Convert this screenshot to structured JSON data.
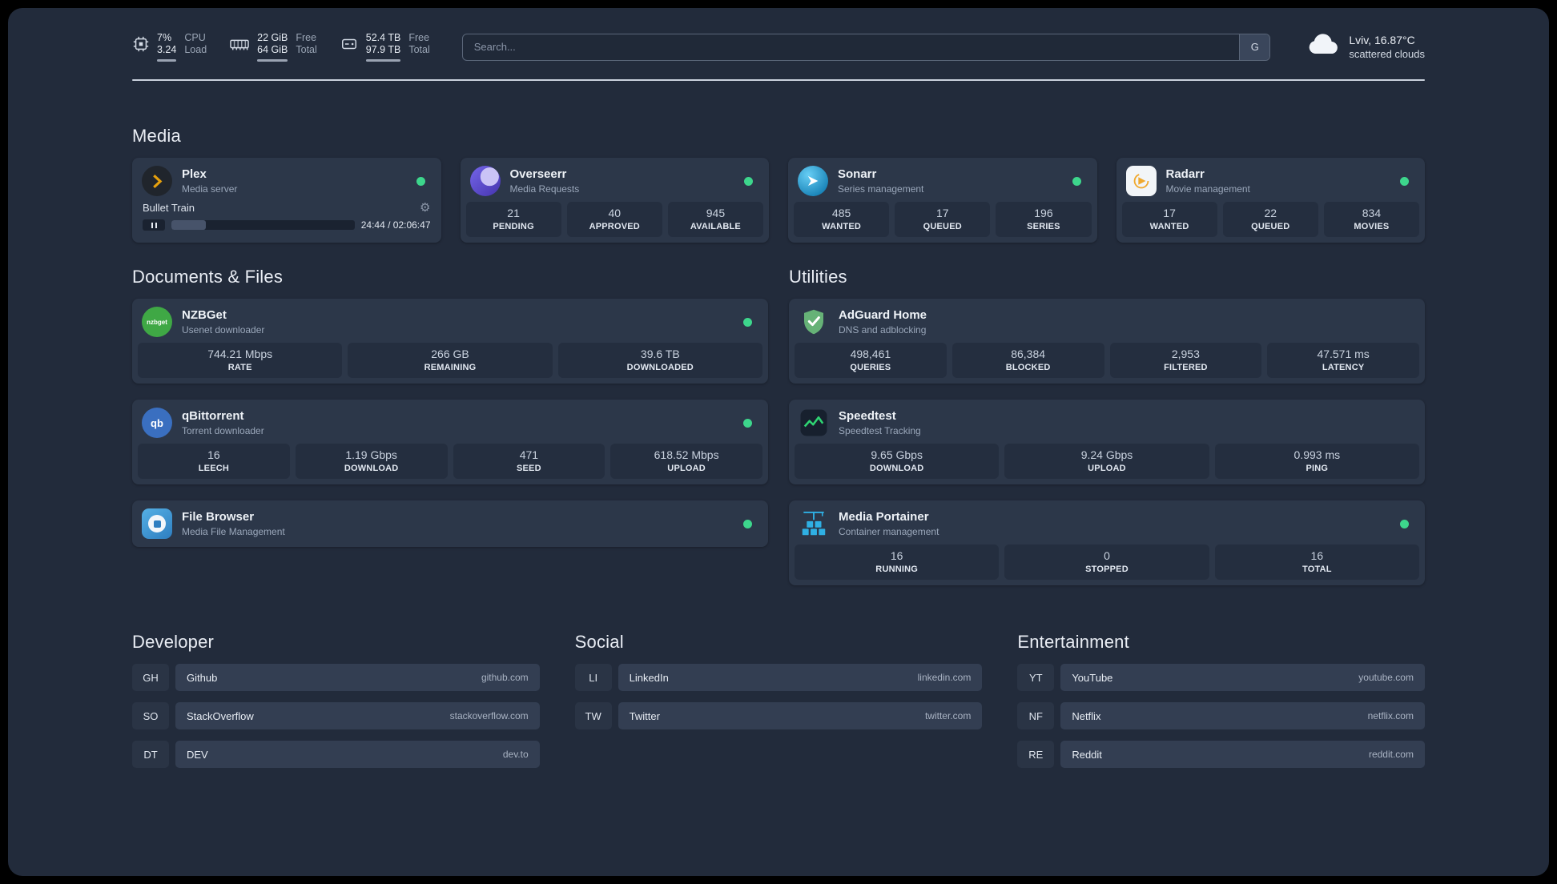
{
  "icons": {
    "gear": "⚙"
  },
  "topbar": {
    "cpu": {
      "value_top": "7%",
      "value_bottom": "3.24",
      "label_top": "CPU",
      "label_bottom": "Load"
    },
    "ram": {
      "value_top": "22 GiB",
      "value_bottom": "64 GiB",
      "label_top": "Free",
      "label_bottom": "Total"
    },
    "disk": {
      "value_top": "52.4 TB",
      "value_bottom": "97.9 TB",
      "label_top": "Free",
      "label_bottom": "Total"
    },
    "search": {
      "placeholder": "Search...",
      "button_label": "G"
    },
    "weather": {
      "location": "Lviv, 16.87°C",
      "condition": "scattered clouds"
    }
  },
  "section_titles": {
    "media": "Media",
    "documents": "Documents & Files",
    "utilities": "Utilities",
    "developer": "Developer",
    "social": "Social",
    "entertainment": "Entertainment"
  },
  "apps": {
    "plex": {
      "name": "Plex",
      "desc": "Media server",
      "now_playing": "Bullet Train",
      "time": "24:44 / 02:06:47",
      "progress_percent": 19
    },
    "overseerr": {
      "name": "Overseerr",
      "desc": "Media Requests",
      "stats": [
        {
          "value": "21",
          "label": "PENDING"
        },
        {
          "value": "40",
          "label": "APPROVED"
        },
        {
          "value": "945",
          "label": "AVAILABLE"
        }
      ]
    },
    "sonarr": {
      "name": "Sonarr",
      "desc": "Series management",
      "stats": [
        {
          "value": "485",
          "label": "WANTED"
        },
        {
          "value": "17",
          "label": "QUEUED"
        },
        {
          "value": "196",
          "label": "SERIES"
        }
      ]
    },
    "radarr": {
      "name": "Radarr",
      "desc": "Movie management",
      "stats": [
        {
          "value": "17",
          "label": "WANTED"
        },
        {
          "value": "22",
          "label": "QUEUED"
        },
        {
          "value": "834",
          "label": "MOVIES"
        }
      ]
    },
    "nzbget": {
      "name": "NZBGet",
      "desc": "Usenet downloader",
      "icon_text": "nzbget",
      "stats": [
        {
          "value": "744.21 Mbps",
          "label": "RATE"
        },
        {
          "value": "266 GB",
          "label": "REMAINING"
        },
        {
          "value": "39.6 TB",
          "label": "DOWNLOADED"
        }
      ]
    },
    "qbittorrent": {
      "name": "qBittorrent",
      "desc": "Torrent downloader",
      "icon_text": "qb",
      "stats": [
        {
          "value": "16",
          "label": "LEECH"
        },
        {
          "value": "1.19 Gbps",
          "label": "DOWNLOAD"
        },
        {
          "value": "471",
          "label": "SEED"
        },
        {
          "value": "618.52 Mbps",
          "label": "UPLOAD"
        }
      ]
    },
    "filebrowser": {
      "name": "File Browser",
      "desc": "Media File Management"
    },
    "adguard": {
      "name": "AdGuard Home",
      "desc": "DNS and adblocking",
      "stats": [
        {
          "value": "498,461",
          "label": "QUERIES"
        },
        {
          "value": "86,384",
          "label": "BLOCKED"
        },
        {
          "value": "2,953",
          "label": "FILTERED"
        },
        {
          "value": "47.571 ms",
          "label": "LATENCY"
        }
      ]
    },
    "speedtest": {
      "name": "Speedtest",
      "desc": "Speedtest Tracking",
      "stats": [
        {
          "value": "9.65 Gbps",
          "label": "DOWNLOAD"
        },
        {
          "value": "9.24 Gbps",
          "label": "UPLOAD"
        },
        {
          "value": "0.993 ms",
          "label": "PING"
        }
      ]
    },
    "portainer": {
      "name": "Media Portainer",
      "desc": "Container management",
      "stats": [
        {
          "value": "16",
          "label": "RUNNING"
        },
        {
          "value": "0",
          "label": "STOPPED"
        },
        {
          "value": "16",
          "label": "TOTAL"
        }
      ]
    }
  },
  "bookmarks": {
    "developer": [
      {
        "abbr": "GH",
        "name": "Github",
        "url": "github.com"
      },
      {
        "abbr": "SO",
        "name": "StackOverflow",
        "url": "stackoverflow.com"
      },
      {
        "abbr": "DT",
        "name": "DEV",
        "url": "dev.to"
      }
    ],
    "social": [
      {
        "abbr": "LI",
        "name": "LinkedIn",
        "url": "linkedin.com"
      },
      {
        "abbr": "TW",
        "name": "Twitter",
        "url": "twitter.com"
      }
    ],
    "entertainment": [
      {
        "abbr": "YT",
        "name": "YouTube",
        "url": "youtube.com"
      },
      {
        "abbr": "NF",
        "name": "Netflix",
        "url": "netflix.com"
      },
      {
        "abbr": "RE",
        "name": "Reddit",
        "url": "reddit.com"
      }
    ]
  },
  "colors": {
    "status_ok": "#3dd68c",
    "plex_accent": "#e5a00d",
    "divider": "#c9d0db"
  }
}
